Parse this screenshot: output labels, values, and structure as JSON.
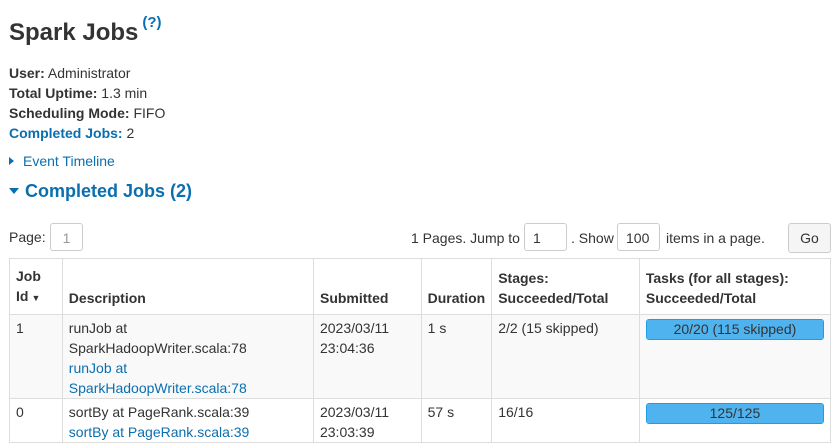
{
  "page": {
    "title": "Spark Jobs",
    "help": "(?)"
  },
  "summary": {
    "user_label": "User:",
    "user": "Administrator",
    "uptime_label": "Total Uptime:",
    "uptime": "1.3 min",
    "scheduling_label": "Scheduling Mode:",
    "scheduling": "FIFO",
    "completed_label": "Completed Jobs:",
    "completed": "2"
  },
  "timeline": {
    "label": "Event Timeline"
  },
  "section": {
    "label": "Completed Jobs (2)"
  },
  "pager": {
    "page_label": "Page:",
    "page_value": "1",
    "pages_text": "1 Pages. Jump to",
    "jump_value": "1",
    "show_text": ". Show",
    "show_value": "100",
    "items_text": "items in a page.",
    "go_label": "Go"
  },
  "table": {
    "headers": {
      "job_id_1": "Job",
      "job_id_2": "Id",
      "sort": "▼",
      "description": "Description",
      "submitted": "Submitted",
      "duration": "Duration",
      "stages_1": "Stages:",
      "stages_2": "Succeeded/Total",
      "tasks_1": "Tasks (for all stages):",
      "tasks_2": "Succeeded/Total"
    },
    "rows": [
      {
        "id": "1",
        "desc_main": "runJob at SparkHadoopWriter.scala:78",
        "desc_link": "runJob at SparkHadoopWriter.scala:78",
        "submitted_date": "2023/03/11",
        "submitted_time": "23:04:36",
        "duration": "1 s",
        "stages": "2/2 (15 skipped)",
        "tasks": "20/20 (115 skipped)",
        "tasks_fraction": 1.0
      },
      {
        "id": "0",
        "desc_main": "sortBy at PageRank.scala:39",
        "desc_link": "sortBy at PageRank.scala:39",
        "submitted_date": "2023/03/11",
        "submitted_time": "23:03:39",
        "duration": "57 s",
        "stages": "16/16",
        "tasks": "125/125",
        "tasks_fraction": 1.0
      }
    ]
  }
}
